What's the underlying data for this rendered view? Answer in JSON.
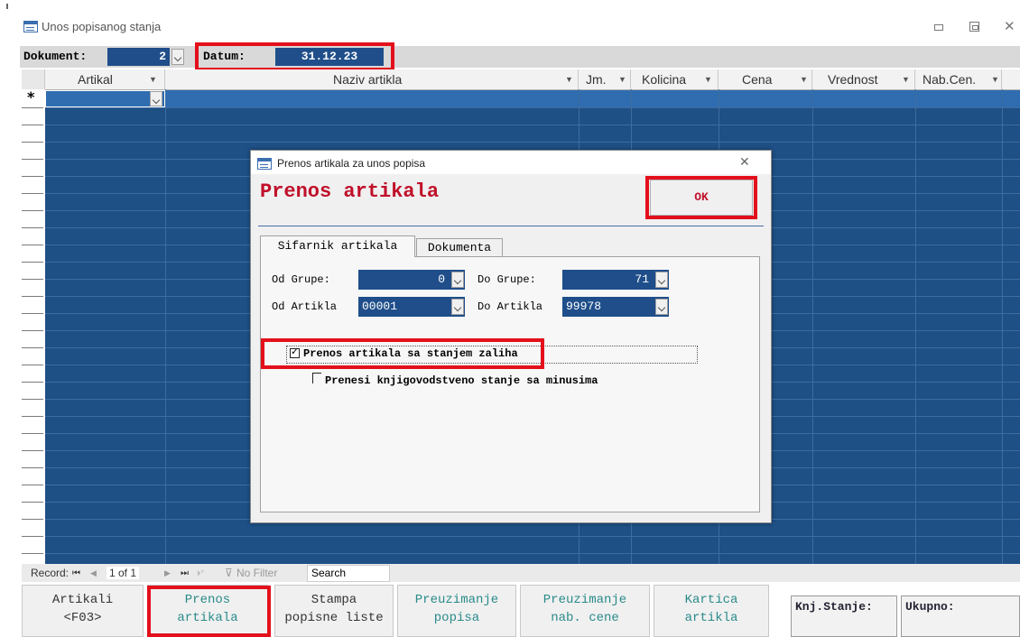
{
  "window": {
    "title": "Unos popisanog stanja"
  },
  "header": {
    "dokument_label": "Dokument:",
    "dokument_value": "2",
    "datum_label": "Datum:",
    "datum_value": "31.12.23"
  },
  "grid": {
    "columns": [
      "Artikal",
      "Naziv artikla",
      "Jm.",
      "Kolicina",
      "Cena",
      "Vrednost",
      "Nab.Cen."
    ],
    "new_row_marker": "*"
  },
  "status_bar": {
    "record_label": "Record:",
    "first": "⏮",
    "prev": "◀",
    "position": "1 of 1",
    "next": "▶",
    "last": "⏭",
    "new": "⏵*",
    "filter": "No Filter",
    "search": "Search"
  },
  "bottom_buttons": [
    {
      "line1": "Artikali",
      "line2": "<F03>"
    },
    {
      "line1": "Prenos",
      "line2": "artikala"
    },
    {
      "line1": "Stampa",
      "line2": "popisne liste"
    },
    {
      "line1": "Preuzimanje",
      "line2": "popisa"
    },
    {
      "line1": "Preuzimanje",
      "line2": "nab. cene"
    },
    {
      "line1": "Kartica",
      "line2": "artikla"
    }
  ],
  "info": {
    "knj_stanje": "Knj.Stanje:",
    "ukupno": "Ukupno:"
  },
  "dialog": {
    "title": "Prenos artikala za unos popisa",
    "heading": "Prenos artikala",
    "ok": "OK",
    "tabs": [
      "Sifarnik artikala",
      "Dokumenta"
    ],
    "od_grupe_label": "Od Grupe:",
    "od_grupe_value": "0",
    "do_grupe_label": "Do Grupe:",
    "do_grupe_value": "71",
    "od_artikla_label": "Od Artikla",
    "od_artikla_value": "00001",
    "do_artikla_label": "Do Artikla",
    "do_artikla_value": "99978",
    "check1_label": "Prenos artikala sa stanjem zaliha",
    "check1_checked": "✓",
    "check2_label": "Prenesi knjigovodstveno stanje sa minusima"
  },
  "colors": {
    "grid_bg": "#1e4f85",
    "highlight": "#e3101c",
    "field_bg": "#1f4e8a"
  }
}
